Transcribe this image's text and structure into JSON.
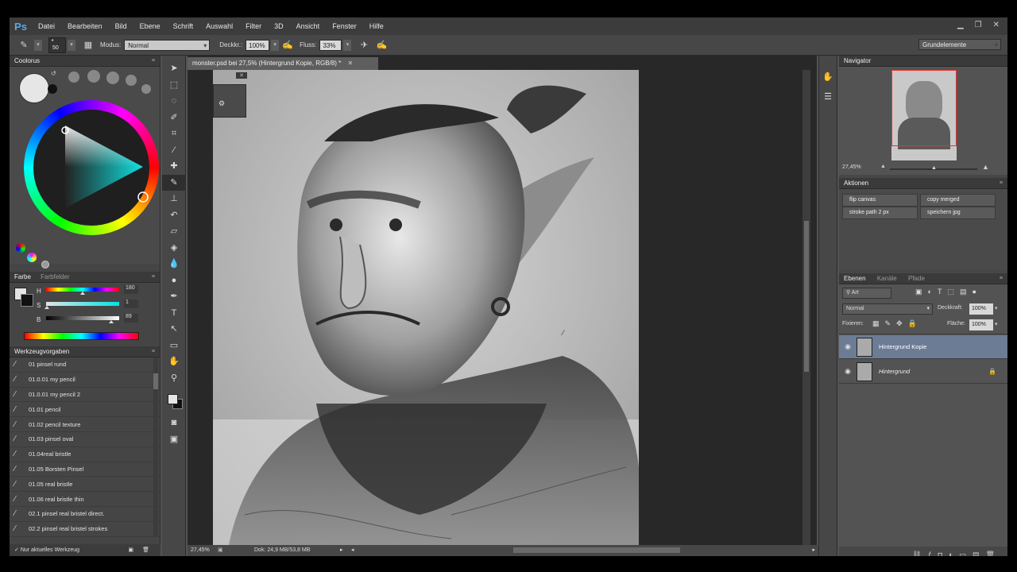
{
  "app": {
    "logo": "Ps"
  },
  "menu": [
    "Datei",
    "Bearbeiten",
    "Bild",
    "Ebene",
    "Schrift",
    "Auswahl",
    "Filter",
    "3D",
    "Ansicht",
    "Fenster",
    "Hilfe"
  ],
  "window_controls": [
    "minimize-icon",
    "restore-icon",
    "close-icon"
  ],
  "options": {
    "brush_size": "50",
    "modus_label": "Modus:",
    "modus_value": "Normal",
    "deckkr_label": "Deckkr.:",
    "deckkr_value": "100%",
    "fluss_label": "Fluss:",
    "fluss_value": "33%",
    "workspace": "Grundelemente"
  },
  "coolorus": {
    "title": "Coolorus"
  },
  "color_panel": {
    "tabs": [
      "Farbe",
      "Farbfelder"
    ],
    "h_label": "H",
    "h_value": "180",
    "s_label": "S",
    "s_value": "1",
    "b_label": "B",
    "b_value": "89",
    "h_fraction": 0.5,
    "s_fraction": 0.01,
    "b_fraction": 0.89
  },
  "brush_presets": {
    "title": "Werkzeugvorgaben",
    "items": [
      "01 pinsel rund",
      "01.0.01 my pencil",
      "01.0.01 my pencil 2",
      "01.01 pencil",
      "01.02 pencil texture",
      "01.03 pinsel oval",
      "01.04real bristle",
      "01.05 Borsten Pinsel",
      "01.05 real bristle",
      "01.06 real bristle thin",
      "02.1 pinsel real bristel direct.",
      "02.2 pinsel real bristel strokes"
    ],
    "footer": "Nur aktuelles Werkzeug"
  },
  "tools": [
    "move-icon",
    "marquee-icon",
    "lasso-icon",
    "quick-select-icon",
    "crop-icon",
    "eyedropper-icon",
    "healing-icon",
    "brush-icon",
    "stamp-icon",
    "history-brush-icon",
    "eraser-icon",
    "paint-bucket-icon",
    "blur-icon",
    "dodge-icon",
    "pen-icon",
    "type-icon",
    "path-select-icon",
    "rectangle-icon",
    "hand-icon",
    "zoom-icon"
  ],
  "document": {
    "tab_title": "monster.psd bei 27,5% (Hintergrund Kopie, RGB/8) *",
    "zoom": "27,45%",
    "doc_info": "Dok: 24,9 MB/53,8 MB"
  },
  "navigator": {
    "title": "Navigator",
    "zoom": "27,45%"
  },
  "actions": {
    "title": "Aktionen",
    "items": [
      "flip canvas",
      "copy merged",
      "stroke path 2 px",
      "speichern jpg"
    ]
  },
  "layers": {
    "tabs": [
      "Ebenen",
      "Kanäle",
      "Pfade"
    ],
    "filter": "Art",
    "blend_mode": "Normal",
    "opacity_label": "Deckkraft:",
    "opacity_value": "100%",
    "lock_label": "Fixieren:",
    "fill_label": "Fläche:",
    "fill_value": "100%",
    "items": [
      {
        "name": "Hintergrund Kopie",
        "selected": true
      },
      {
        "name": "Hintergrund",
        "selected": false,
        "locked": true
      }
    ]
  }
}
